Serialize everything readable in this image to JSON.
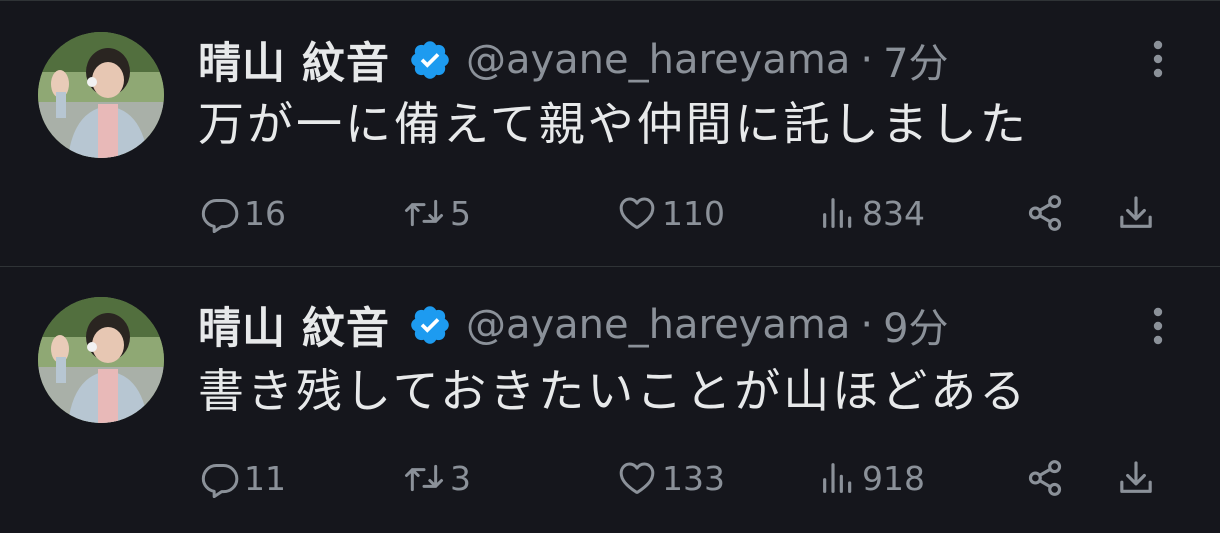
{
  "tweets": [
    {
      "display_name": "晴山 紋音",
      "handle": "@ayane_hareyama",
      "separator": "·",
      "time": "7分",
      "text": "万が一に備えて親や仲間に託しました",
      "stats": {
        "replies": "16",
        "retweets": "5",
        "likes": "110",
        "views": "834"
      }
    },
    {
      "display_name": "晴山 紋音",
      "handle": "@ayane_hareyama",
      "separator": "·",
      "time": "9分",
      "text": "書き残しておきたいことが山ほどある",
      "stats": {
        "replies": "11",
        "retweets": "3",
        "likes": "133",
        "views": "918"
      }
    }
  ],
  "icons": {
    "verified": "verified-badge-icon",
    "more": "more-vertical-icon",
    "reply": "reply-icon",
    "retweet": "retweet-icon",
    "like": "heart-icon",
    "views": "views-icon",
    "share": "share-icon",
    "download": "download-icon"
  },
  "colors": {
    "background": "#15161c",
    "text": "#e7e9ea",
    "muted": "#8b9199",
    "verified": "#1d9bf0",
    "divider": "#2f3336"
  }
}
